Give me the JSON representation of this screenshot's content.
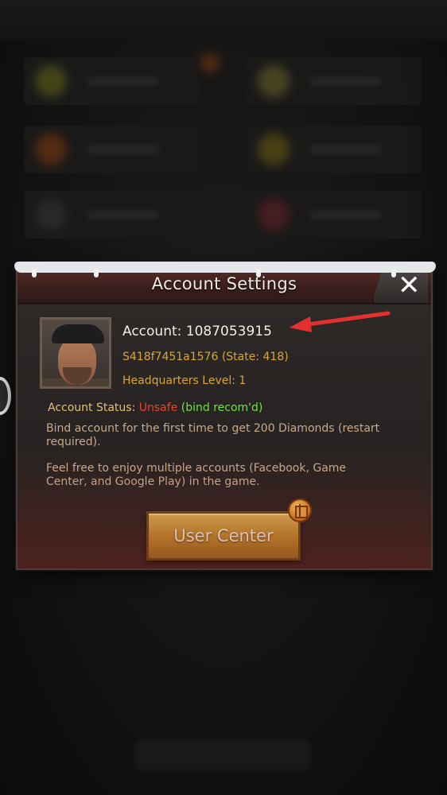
{
  "dialog": {
    "title": "Account Settings",
    "close_label": "✕",
    "account_label": "Account:",
    "account_id": "1087053915",
    "server_state": "S418f7451a1576 (State: 418)",
    "hq_level": "Headquarters Level: 1",
    "status_label": "Account Status:",
    "status_value": "Unsafe",
    "status_hint": "(bind recom'd)",
    "bind_text": "Bind account for the first time to get 200 Diamonds (restart required).",
    "multi_text": "Feel free to enjoy multiple accounts (Facebook, Game Center, and Google Play) in the game.",
    "user_center_label": "User Center"
  },
  "colors": {
    "unsafe": "#e8442e",
    "bind_hint": "#6fe23b",
    "gold_text": "#d9a534",
    "annotation_arrow": "#e53030"
  },
  "icons": {
    "close": "close-icon",
    "gift": "gift-icon",
    "arrow": "red-arrow-annotation"
  }
}
